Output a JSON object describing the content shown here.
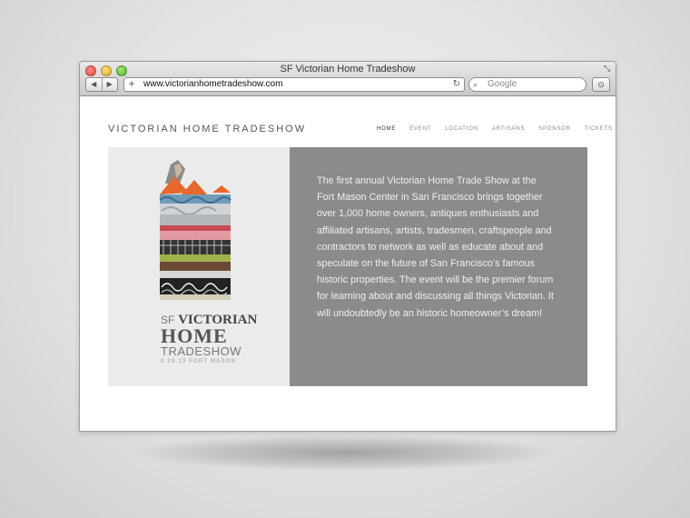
{
  "window": {
    "title": "SF Victorian Home Tradeshow",
    "url": "www.victorianhometradeshow.com",
    "search_placeholder": "Google",
    "back_icon": "◀",
    "forward_icon": "▶",
    "add_icon": "+",
    "reload_icon": "↻",
    "search_icon": "⌕",
    "extra_icon": "⊙",
    "resize_icon": "⤡"
  },
  "site": {
    "title": "VICTORIAN HOME TRADESHOW",
    "nav": [
      "HOME",
      "EVENT",
      "LOCATION",
      "ARTISANS",
      "SPONSOR",
      "TICKETS"
    ],
    "active_nav": "HOME"
  },
  "poster": {
    "line1_sf": "SF",
    "line1_victorian": "VICTORIAN",
    "line2": "HOME",
    "line3": "TRADESHOW",
    "line4": "9.29.13 FORT MASON"
  },
  "description": "The first annual Victorian Home Trade Show at the Fort Mason Center in San Francisco brings together over 1,000 home owners, antiques enthusiasts and affiliated artisans, artists, tradesmen, craftspeople and contractors to network as well as educate about and speculate on the future of San Francisco’s famous historic properties. The event will be the premier forum for learning about and discussing all things Victorian. It will undoubtedly be an historic homeowner’s dream!",
  "colors": {
    "panel_gray": "#8b8b8b",
    "poster_bg": "#ebebeb",
    "roof_orange": "#e8672a"
  }
}
